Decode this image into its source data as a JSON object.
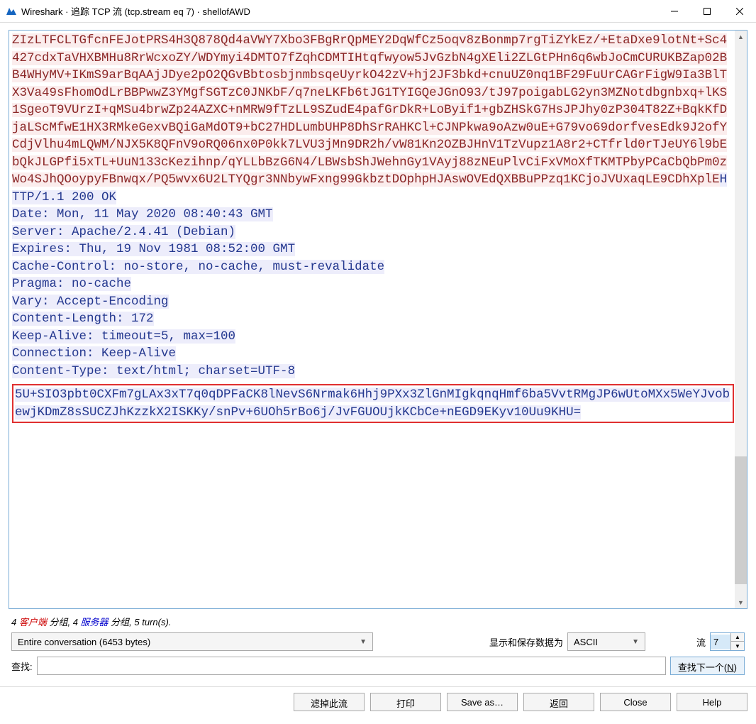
{
  "window": {
    "title": "Wireshark · 追踪 TCP 流 (tcp.stream eq 7) · shellofAWD"
  },
  "stream": {
    "request_block": "ZIzLTFCLTGfcnFEJotPRS4H3Q878Qd4aVWY7Xbo3FBgRrQpMEY2DqWfCz5oqv8zBonmp7rgTiZYkEz/+EtaDxe9lotNt+Sc4427cdxTaVHXBMHu8RrWcxoZY/WDYmyi4DMTO7fZqhCDMTIHtqfwyow5JvGzbN4gXEli2ZLGtPHn6q6wbJoCmCURUKBZap02BB4WHyMV+IKmS9arBqAAjJDye2pO2QGvBbtosbjnmbsqeUyrkO42zV+hj2JF3bkd+cnuUZ0nq1BF29FuUrCAGrFigW9Ia3BlTX3Va49sFhomOdLrBBPwwZ3YMgfSGTzC0JNKbF/q7neLKFb6tJG1TYIGQeJGnO93/tJ97poigabLG2yn3MZNotdbgnbxq+lKS1SgeoT9VUrzI+qMSu4brwZp24AZXC+nMRW9fTzLL9SZudE4pafGrDkR+LoByif1+gbZHSkG7HsJPJhy0zP304T82Z+BqkKfDjaLScMfwE1HX3RMkeGexvBQiGaMdOT9+bC27HDLumbUHP8DhSrRAHKCl+CJNPkwa9oAzw0uE+G79vo69dorfvesEdk9J2ofYCdjVlhu4mLQWM/NJX5K8QFnV9oRQ06nx0P0kk7LVU3jMn9DR2h/vW81Kn2OZBJHnV1TzVupz1A8r2+CTfrld0rTJeUY6l9bEbQkJLGPfi5xTL+UuN133cKezihnp/qYLLbBzG6N4/LBWsbShJWehnGy1VAyj88zNEuPlvCiFxVMoXfTKMTPbyPCaCbQbPm0zWo4SJhQOoypyFBnwqx/PQ5wvx6U2LTYQgr3NNbywFxng99GkbztDOphpHJAswOVEdQXBBuPPzq1KCjoJVUxaqLE9CDhXplE",
    "resp_http": "HTTP/1.1 200 OK",
    "response_headers": "Date: Mon, 11 May 2020 08:40:43 GMT\nServer: Apache/2.4.41 (Debian)\nExpires: Thu, 19 Nov 1981 08:52:00 GMT\nCache-Control: no-store, no-cache, must-revalidate\nPragma: no-cache\nVary: Accept-Encoding\nContent-Length: 172\nKeep-Alive: timeout=5, max=100\nConnection: Keep-Alive\nContent-Type: text/html; charset=UTF-8",
    "highlighted_block": "5U+SIO3pbt0CXFm7gLAx3xT7q0qDPFaCK8lNevS6Nrmak6Hhj9PXx3ZlGnMIgkqnqHmf6ba5VvtRMgJP6wUtoMXx5WeYJvobewjKDmZ8sSUCZJhKzzkX2ISKKy/snPv+6UOh5rBo6j/JvFGUOUjkKCbCe+nEGD9EKyv10Uu9KHU="
  },
  "stats": {
    "client_pkts": "4 ",
    "client_word": "客户端",
    "mid1": " 分组, ",
    "srv_pkts": "4 ",
    "server_word": "服务器",
    "mid2": " 分组, ",
    "turns": "5 turn(s)."
  },
  "filters": {
    "conversation": "Entire conversation (6453 bytes)",
    "save_as_label": "显示和保存数据为",
    "encoding": "ASCII",
    "stream_label": "流",
    "stream_number": "7"
  },
  "find": {
    "label": "查找:",
    "next_button_prefix": "查找下一个(",
    "next_button_key": "N",
    "next_button_suffix": ")"
  },
  "buttons": {
    "filter_out": "滤掉此流",
    "print": "打印",
    "save_as": "Save as…",
    "back": "返回",
    "close": "Close",
    "help": "Help"
  }
}
